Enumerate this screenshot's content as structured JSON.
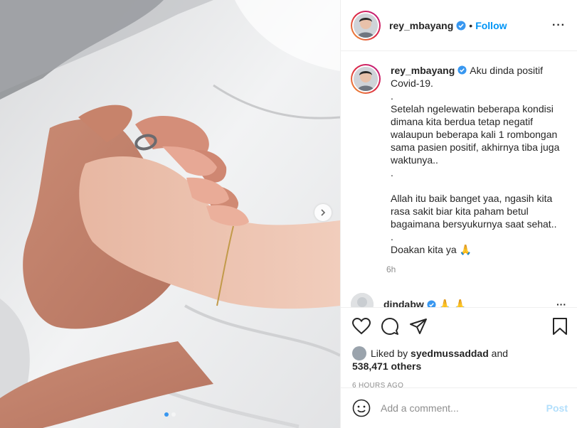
{
  "post": {
    "username": "rey_mbayang",
    "follow_label": "Follow",
    "bullet": "•",
    "more_label": "···",
    "caption_lines": "Aku dinda positif Covid-19.\n.\nSetelah ngelewatin beberapa kondisi dimana kita berdua tetap negatif walaupun beberapa kali 1 rombongan sama pasien positif, akhirnya tiba juga waktunya..\n.\n\nAllah itu baik banget yaa, ngasih kita rasa sakit biar kita paham betul bagaimana bersyukurnya saat sehat..\n.\nDoakan kita ya 🙏",
    "time": "6h",
    "second_comment_user": "dindabw",
    "second_comment_tail": "🙏 🙏",
    "liked_prefix": "Liked by",
    "liked_user": "syedmussaddad",
    "liked_and": "and",
    "likes_count": "538,471 others",
    "posted_ago": "6 HOURS AGO",
    "comment_placeholder": "Add a comment...",
    "post_label": "Post"
  },
  "icons": {
    "verified": "verified-badge-icon",
    "like": "heart-icon",
    "comment": "comment-icon",
    "share": "share-icon",
    "save": "bookmark-icon",
    "emoji": "emoji-icon",
    "next": "chevron-right-icon"
  },
  "carousel": {
    "count": 2,
    "active": 0
  },
  "colors": {
    "accent": "#0095f6",
    "verified": "#3897f0",
    "muted": "#8e8e8e",
    "post_disabled": "#b2dffc"
  }
}
